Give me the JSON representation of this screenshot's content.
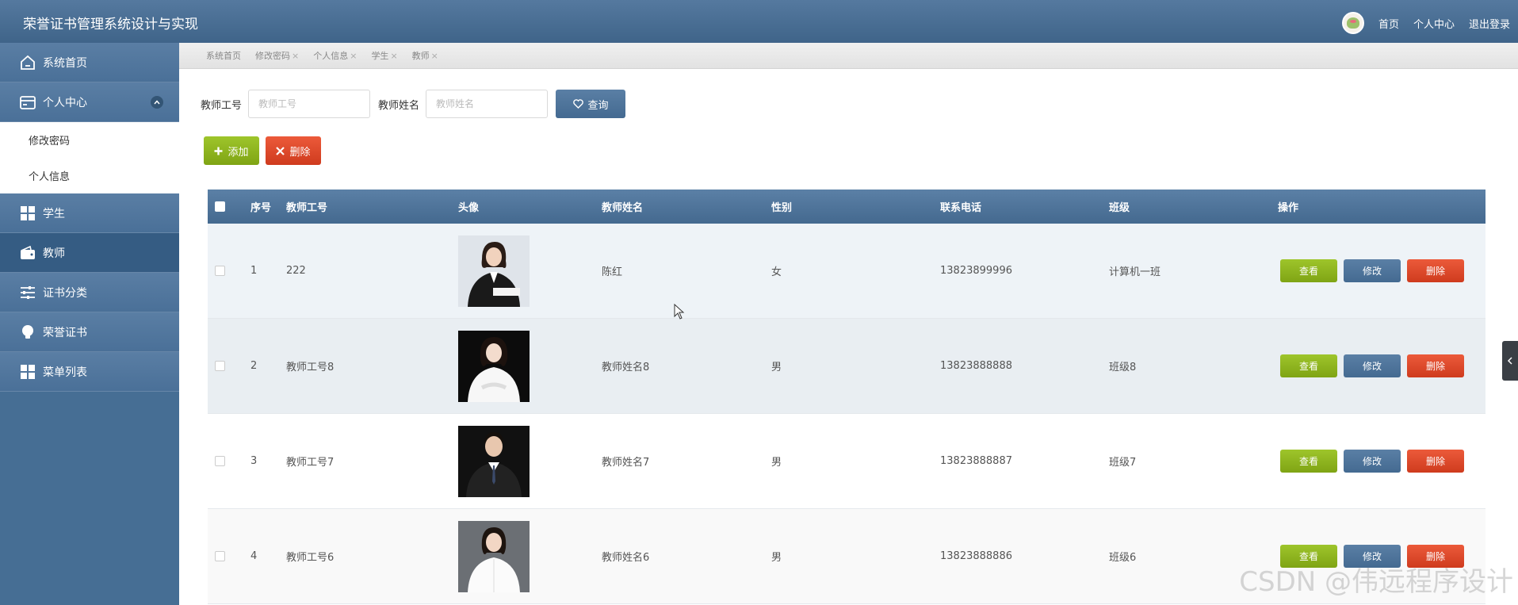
{
  "app": {
    "title": "荣誉证书管理系统设计与实现",
    "nav": [
      "首页",
      "个人中心",
      "退出登录"
    ]
  },
  "sidebar": {
    "items": [
      {
        "label": "系统首页",
        "icon": "home-icon"
      },
      {
        "label": "个人中心",
        "icon": "card-icon",
        "expanded": true,
        "children": [
          {
            "label": "修改密码"
          },
          {
            "label": "个人信息"
          }
        ]
      },
      {
        "label": "学生",
        "icon": "grid-icon"
      },
      {
        "label": "教师",
        "icon": "wallet-icon",
        "active": true
      },
      {
        "label": "证书分类",
        "icon": "sliders-icon"
      },
      {
        "label": "荣誉证书",
        "icon": "bulb-icon"
      },
      {
        "label": "菜单列表",
        "icon": "grid-icon"
      }
    ]
  },
  "tabs": [
    {
      "label": "系统首页",
      "closable": false
    },
    {
      "label": "修改密码",
      "closable": true
    },
    {
      "label": "个人信息",
      "closable": true
    },
    {
      "label": "学生",
      "closable": true
    },
    {
      "label": "教师",
      "closable": true
    }
  ],
  "tab_close": "×",
  "search": {
    "fields": [
      {
        "label": "教师工号",
        "placeholder": "教师工号",
        "value": ""
      },
      {
        "label": "教师姓名",
        "placeholder": "教师姓名",
        "value": ""
      }
    ],
    "button": "查询"
  },
  "toolbar": {
    "add": "添加",
    "delete": "删除"
  },
  "table": {
    "columns": [
      "序号",
      "教师工号",
      "头像",
      "教师姓名",
      "性别",
      "联系电话",
      "班级",
      "操作"
    ],
    "rows": [
      {
        "no": "1",
        "id": "222",
        "name": "陈红",
        "gender": "女",
        "phone": "13823899996",
        "class": "计算机一班"
      },
      {
        "no": "2",
        "id": "教师工号8",
        "name": "教师姓名8",
        "gender": "男",
        "phone": "13823888888",
        "class": "班级8"
      },
      {
        "no": "3",
        "id": "教师工号7",
        "name": "教师姓名7",
        "gender": "男",
        "phone": "13823888887",
        "class": "班级7"
      },
      {
        "no": "4",
        "id": "教师工号6",
        "name": "教师姓名6",
        "gender": "男",
        "phone": "13823888886",
        "class": "班级6"
      }
    ],
    "row_actions": {
      "view": "查看",
      "edit": "修改",
      "delete": "删除"
    }
  },
  "watermark": "CSDN @伟远程序设计",
  "colors": {
    "header": "#4a6f96",
    "sidebar": "#466e94",
    "green": "#8cb31f",
    "blue": "#4f759b",
    "red": "#e04a2b"
  }
}
